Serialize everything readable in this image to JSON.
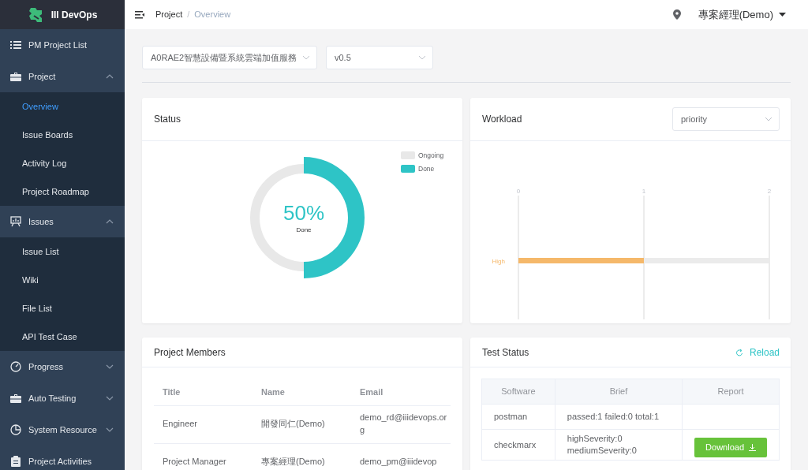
{
  "app": {
    "name": "III DevOps"
  },
  "sidebar": {
    "items": [
      {
        "label": "PM Project List",
        "kind": "link",
        "selected": false
      },
      {
        "label": "Project",
        "kind": "group",
        "selected": false,
        "expanded": true,
        "children": [
          {
            "label": "Overview",
            "selected": true
          },
          {
            "label": "Issue Boards",
            "selected": false
          },
          {
            "label": "Activity Log",
            "selected": false
          },
          {
            "label": "Project Roadmap",
            "selected": false
          }
        ]
      },
      {
        "label": "Issues",
        "kind": "group",
        "selected": false,
        "expanded": true,
        "children": [
          {
            "label": "Issue List",
            "selected": false
          },
          {
            "label": "Wiki",
            "selected": false
          },
          {
            "label": "File List",
            "selected": false
          },
          {
            "label": "API Test Case",
            "selected": false
          }
        ]
      },
      {
        "label": "Progress",
        "kind": "group",
        "selected": false,
        "expanded": false
      },
      {
        "label": "Auto Testing",
        "kind": "group",
        "selected": false,
        "expanded": false
      },
      {
        "label": "System Resource",
        "kind": "group",
        "selected": false,
        "expanded": false
      },
      {
        "label": "Project Activities",
        "kind": "link",
        "selected": false
      }
    ]
  },
  "topbar": {
    "breadcrumb": [
      "Project",
      "Overview"
    ],
    "separator": "/",
    "user": "專案經理(Demo)"
  },
  "filters": {
    "project": "A0RAE2智慧設備暨系統雲端加值服務",
    "version": "v0.5"
  },
  "status": {
    "title": "Status",
    "center_value": "50%",
    "center_label": "Done",
    "chart_data": {
      "type": "donut",
      "legend": "top-right",
      "series": [
        {
          "name": "Done",
          "color": "#2ec4c6",
          "values": [
            1
          ]
        },
        {
          "name": "Ongoing",
          "color": "#e8e8e8",
          "values": [
            1
          ]
        }
      ]
    }
  },
  "workload": {
    "title": "Workload",
    "group_by": "priority",
    "chart_data": {
      "type": "bar",
      "orientation": "horizontal",
      "categories": [
        "High"
      ],
      "xlim": [
        0,
        2
      ],
      "xticks": [
        0,
        1,
        2
      ],
      "series": [
        {
          "color": "#f5b86a",
          "values": [
            1
          ]
        }
      ]
    }
  },
  "members": {
    "title": "Project Members",
    "columns": [
      "Title",
      "Name",
      "Email"
    ],
    "rows": [
      [
        "Engineer",
        "開發同仁(Demo)",
        "demo_rd@iiidevops.org"
      ],
      [
        "Project Manager",
        "專案經理(Demo)",
        "demo_pm@iiidevop"
      ]
    ]
  },
  "tests": {
    "title": "Test Status",
    "reload": "Reload",
    "columns": [
      "Software",
      "Brief",
      "Report"
    ],
    "rows": [
      {
        "software": "postman",
        "brief": [
          "passed:1 failed:0 total:1"
        ]
      },
      {
        "software": "checkmarx",
        "brief": [
          "highSeverity:0",
          "mediumSeverity:0"
        ],
        "report": "Download"
      }
    ]
  }
}
